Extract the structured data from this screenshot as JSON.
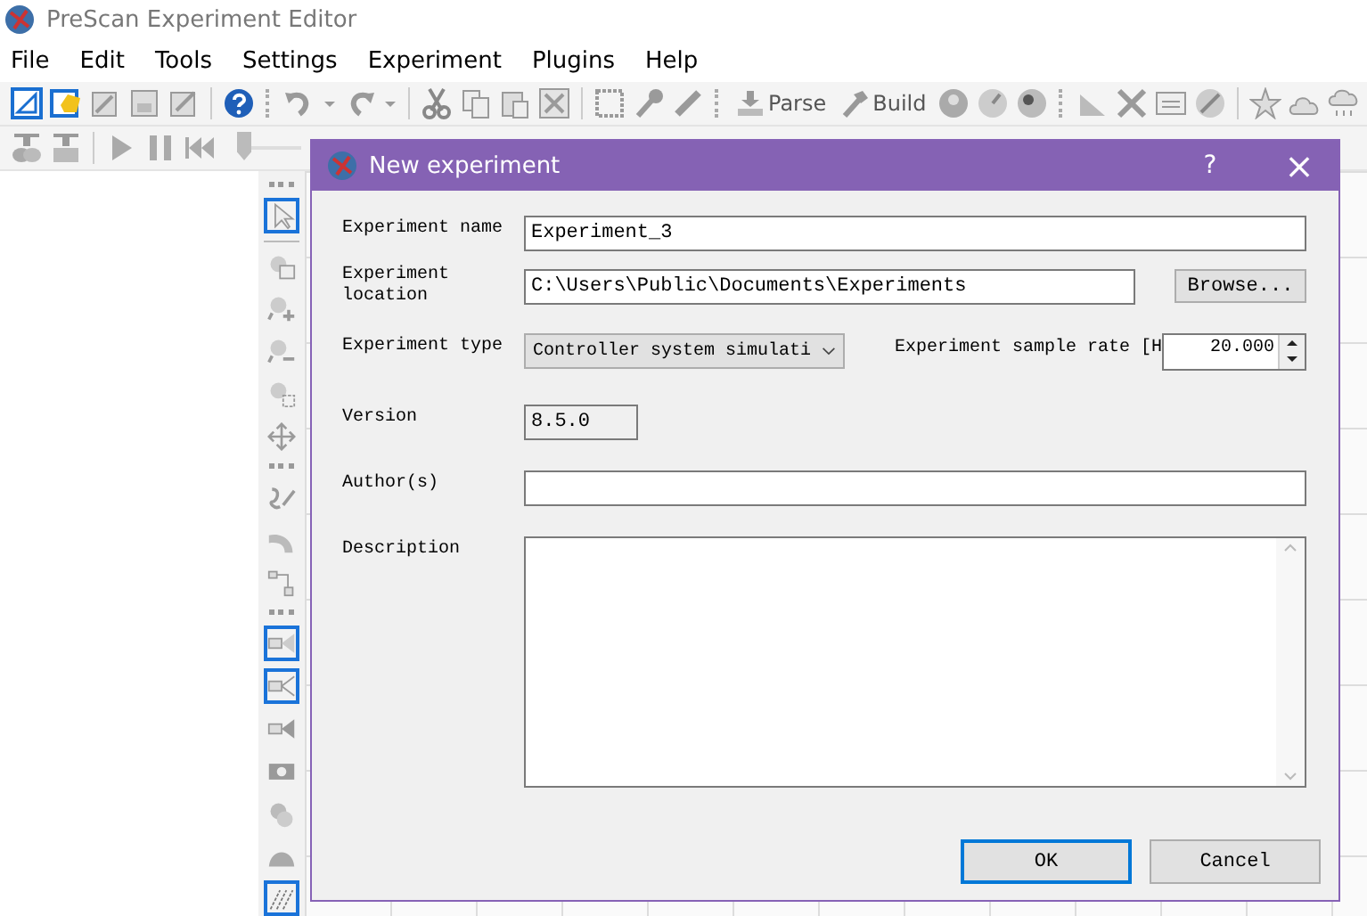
{
  "app": {
    "title": "PreScan Experiment Editor"
  },
  "menu": [
    "File",
    "Edit",
    "Tools",
    "Settings",
    "Experiment",
    "Plugins",
    "Help"
  ],
  "toolbar": {
    "buttons": [
      {
        "label": "Parse"
      },
      {
        "label": "Build"
      }
    ]
  },
  "playback": {
    "level": 0.0
  },
  "palette": [
    {
      "selected": true
    },
    {
      "selected": false
    },
    {
      "selected": false
    },
    {
      "selected": false
    },
    {
      "selected": false
    },
    {
      "selected": false
    },
    {
      "selected": false
    },
    {
      "selected": false
    },
    {
      "selected": false
    },
    {
      "selected": true
    },
    {
      "selected": true
    },
    {
      "selected": false
    },
    {
      "selected": false
    },
    {
      "selected": false
    },
    {
      "selected": false
    },
    {
      "selected": true
    }
  ],
  "dialog": {
    "title": "New experiment",
    "help": "?",
    "close": "×",
    "name_label": "Experiment name",
    "name_value": "Experiment_3",
    "location_label": "Experiment location",
    "location_value": "C:\\Users\\Public\\Documents\\Experiments",
    "browse": "Browse...",
    "type_label": "Experiment type",
    "type_value": "Controller system simulati",
    "rate_label": "Experiment sample rate [H",
    "rate_value": "20.000",
    "version_label": "Version",
    "version_value": "8.5.0",
    "author_label": "Author(s)",
    "description_label": "Description",
    "buttons": [
      "OK",
      "Cancel"
    ]
  }
}
